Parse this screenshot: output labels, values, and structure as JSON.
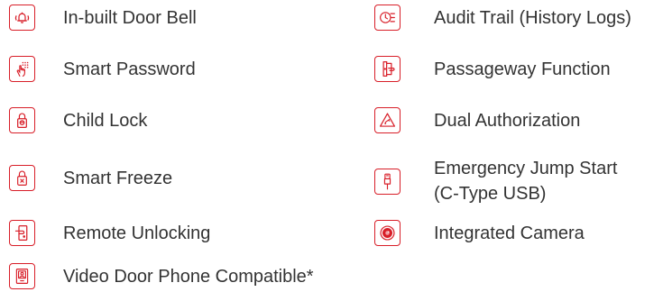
{
  "colors": {
    "accent": "#d81e28",
    "text": "#333333"
  },
  "features_left": [
    {
      "label": "In-built Door Bell",
      "icon": "door-bell-icon"
    },
    {
      "label": "Smart Password",
      "icon": "keypad-touch-icon"
    },
    {
      "label": "Child Lock",
      "icon": "child-lock-icon"
    },
    {
      "label": "Smart Freeze",
      "icon": "freeze-lock-icon"
    },
    {
      "label": "Remote Unlocking",
      "icon": "remote-unlock-icon"
    },
    {
      "label": "Video Door Phone Compatible*",
      "icon": "video-door-phone-icon"
    }
  ],
  "features_right": [
    {
      "label": "Audit Trail (History Logs)",
      "icon": "history-log-icon"
    },
    {
      "label": "Passageway Function",
      "icon": "passageway-door-icon"
    },
    {
      "label": "Dual Authorization",
      "icon": "dual-authorization-icon"
    },
    {
      "label_line1": "Emergency Jump Start",
      "label_line2": "(C-Type USB)",
      "icon": "usb-c-icon"
    },
    {
      "label": "Integrated Camera",
      "icon": "camera-icon"
    }
  ]
}
